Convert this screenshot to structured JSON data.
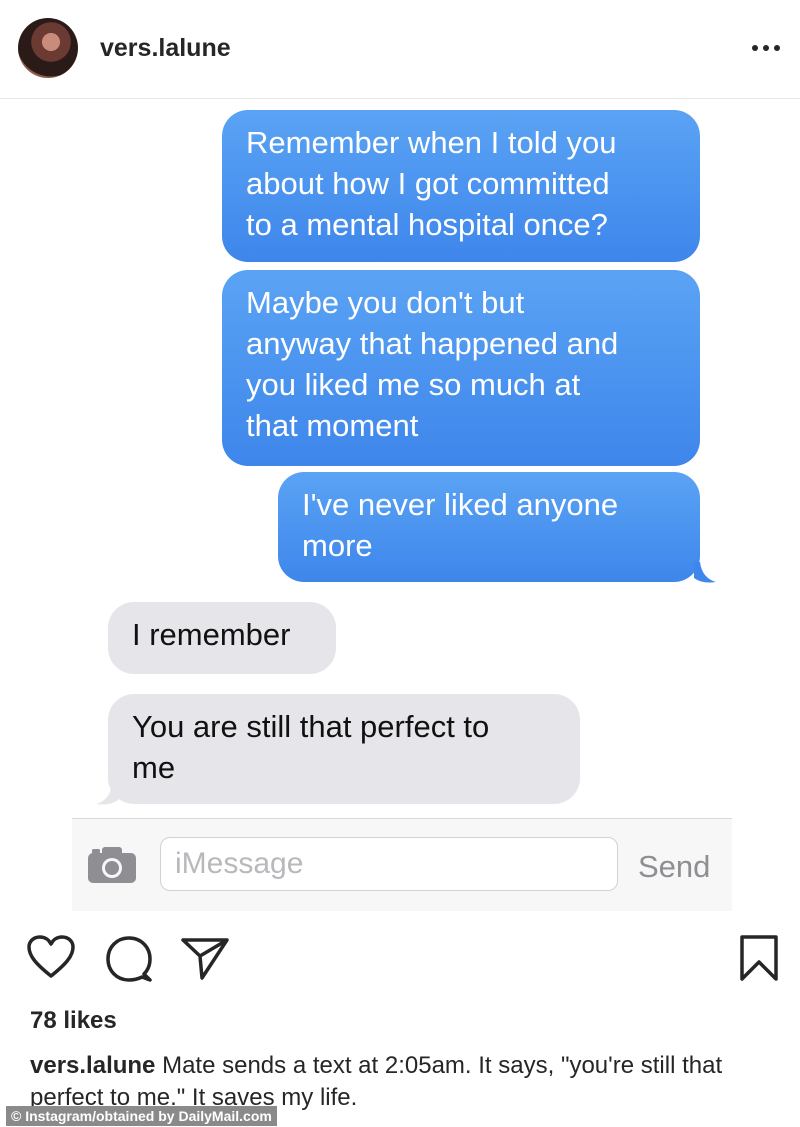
{
  "post": {
    "username": "vers.lalune",
    "more_icon": "more-horizontal-icon"
  },
  "conversation": {
    "messages": [
      {
        "from": "me",
        "text": "Remember when I told you\nabout how I got committed\nto a mental hospital once?"
      },
      {
        "from": "me",
        "text": "Maybe you don't but\nanyway that happened and\nyou liked me so much at\nthat moment"
      },
      {
        "from": "me",
        "text": "I've never liked anyone\nmore"
      },
      {
        "from": "them",
        "text": "I remember"
      },
      {
        "from": "them",
        "text": "You are still that perfect to\nme"
      }
    ],
    "composer": {
      "placeholder": "iMessage",
      "send_label": "Send",
      "camera_icon": "camera-icon"
    },
    "colors": {
      "outgoing": "#4a95f0",
      "incoming": "#e5e5ea"
    }
  },
  "actions": {
    "like_icon": "heart-icon",
    "comment_icon": "comment-icon",
    "share_icon": "send-icon",
    "save_icon": "bookmark-icon"
  },
  "likes": "78 likes",
  "caption": {
    "username": "vers.lalune",
    "text": "Mate sends a text at 2:05am. It says, \"you're still that perfect to me.\" It saves my life."
  },
  "credit": "© Instagram/obtained by DailyMail.com"
}
